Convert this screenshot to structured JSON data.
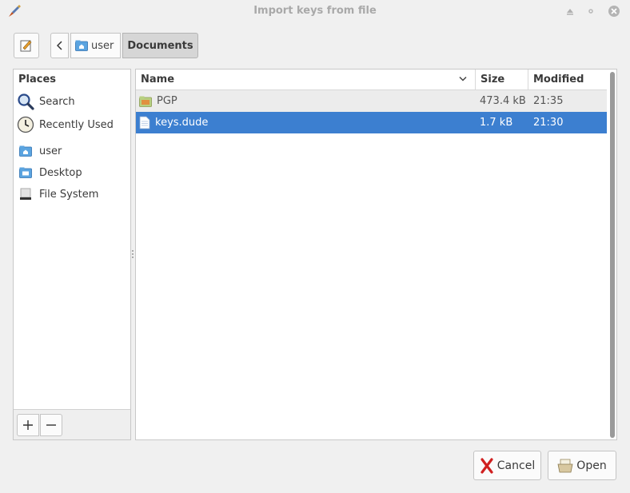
{
  "window": {
    "title": "Import keys from file"
  },
  "pathbar": {
    "crumbs": [
      {
        "label": "user",
        "icon": "home-folder-icon"
      },
      {
        "label": "Documents",
        "active": true
      }
    ]
  },
  "sidebar": {
    "header": "Places",
    "items": [
      {
        "label": "Search",
        "icon": "search-icon"
      },
      {
        "label": "Recently Used",
        "icon": "clock-icon"
      },
      {
        "label": "user",
        "icon": "home-folder-icon"
      },
      {
        "label": "Desktop",
        "icon": "desktop-folder-icon"
      },
      {
        "label": "File System",
        "icon": "drive-icon"
      }
    ]
  },
  "filelist": {
    "columns": {
      "name": "Name",
      "size": "Size",
      "modified": "Modified"
    },
    "rows": [
      {
        "name": "PGP",
        "size": "473.4 kB",
        "modified": "21:35",
        "icon": "folder-icon"
      },
      {
        "name": "keys.dude",
        "size": "1.7 kB",
        "modified": "21:30",
        "icon": "text-file-icon",
        "selected": true
      }
    ]
  },
  "buttons": {
    "cancel": "Cancel",
    "open": "Open"
  },
  "colors": {
    "selection": "#3c7fd0",
    "title_text": "#a9a9a9"
  }
}
